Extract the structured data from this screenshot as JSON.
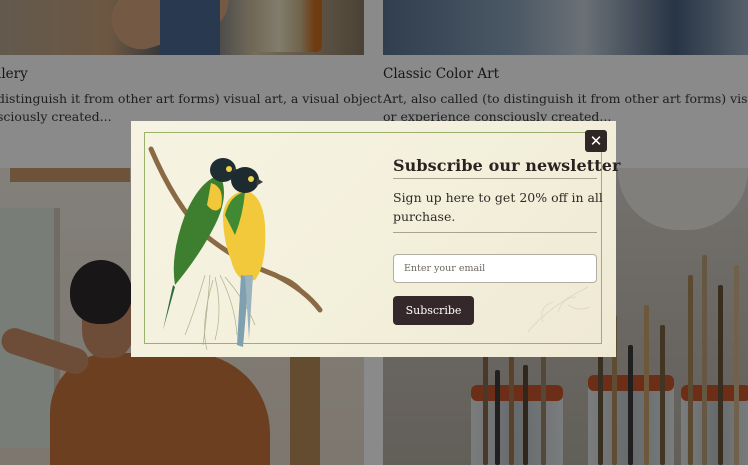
{
  "cards": [
    {
      "title": "llery",
      "description_lines": [
        "distinguish it from other art forms) visual art, a visual object",
        "sciously created..."
      ]
    },
    {
      "title": "Classic Color Art",
      "description_lines": [
        "Art, also called (to distinguish it from other art forms) visual a",
        "or experience consciously created..."
      ]
    }
  ],
  "newsletter": {
    "title": "Subscribe our newsletter",
    "text": "Sign up here to get 20% off in all purchase.",
    "email_placeholder": "Enter your email",
    "email_value": "",
    "subscribe_label": "Subscribe",
    "close_label": "✕"
  },
  "colors": {
    "overlay": "rgba(0,0,0,0.46)",
    "button": "#34282a",
    "border_accent": "#9bb06a"
  },
  "icons": {
    "close": "close-icon",
    "artwork": "parrots-on-branch-illustration"
  }
}
